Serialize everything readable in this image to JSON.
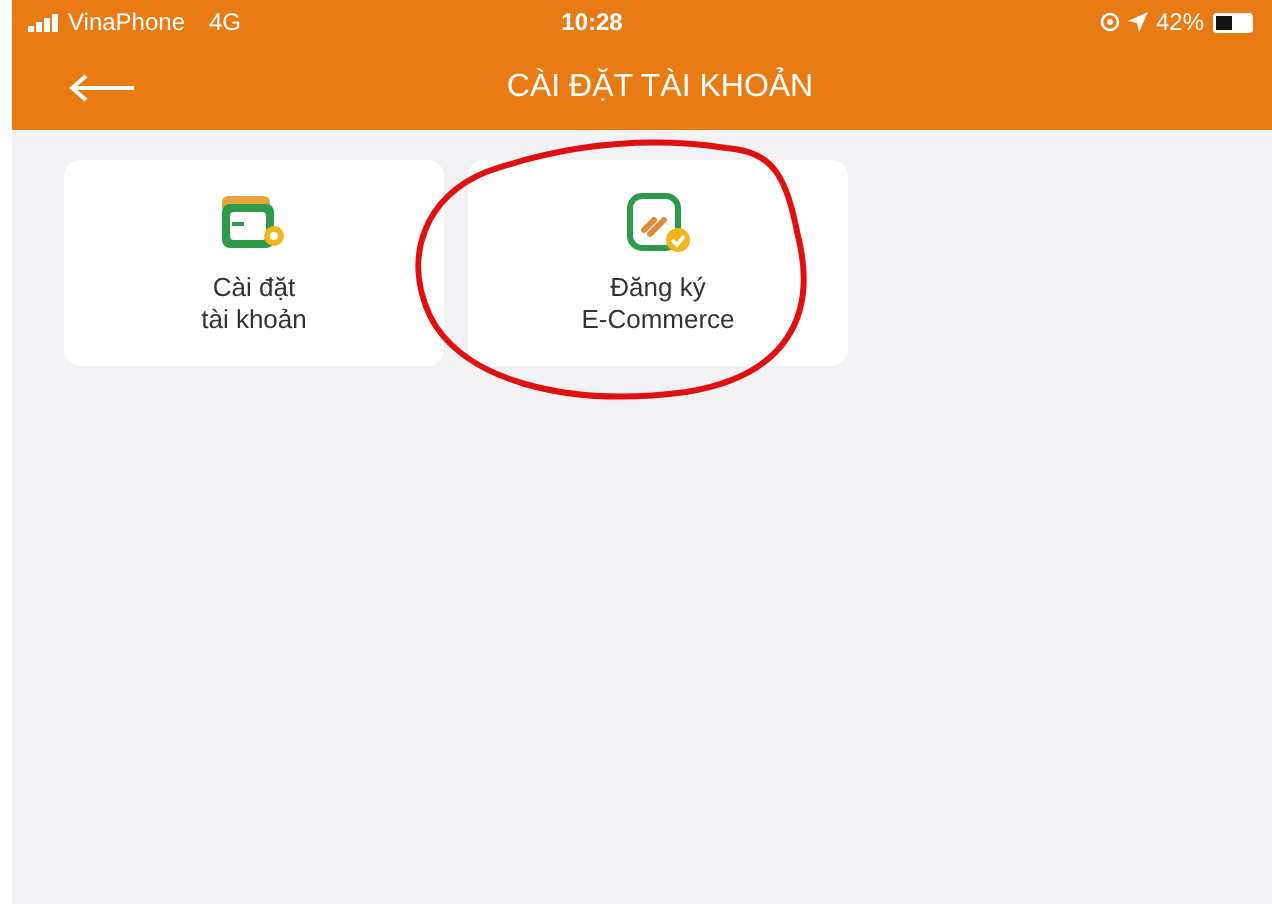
{
  "status_bar": {
    "carrier": "VinaPhone",
    "network": "4G",
    "time": "10:28",
    "battery": "42%"
  },
  "header": {
    "title": "CÀI ĐẶT TÀI KHOẢN"
  },
  "tiles": [
    {
      "kind": "settings",
      "lines": [
        "Cài đặt",
        "tài khoản"
      ]
    },
    {
      "kind": "link",
      "lines": [
        "Đăng ký",
        "E-Commerce"
      ]
    }
  ]
}
